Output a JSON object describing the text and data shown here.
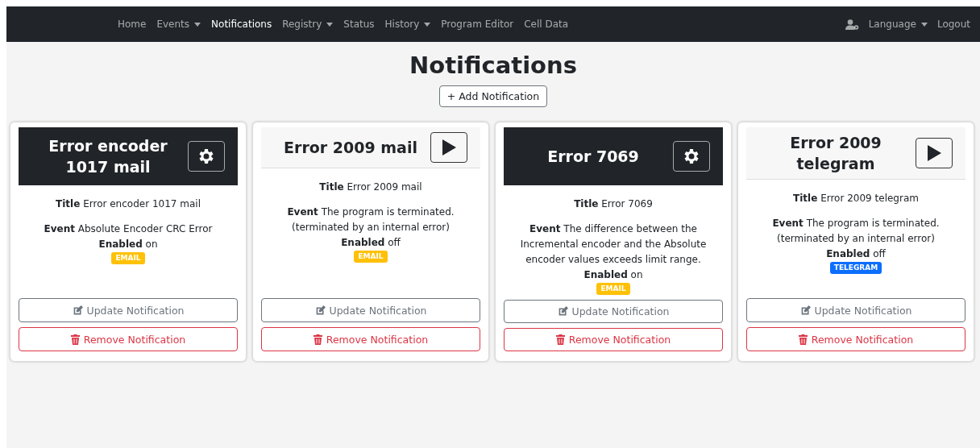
{
  "nav": {
    "items": [
      {
        "label": "Home",
        "selected": false,
        "dropdown": false
      },
      {
        "label": "Events",
        "selected": false,
        "dropdown": true
      },
      {
        "label": "Notifications",
        "selected": true,
        "dropdown": false
      },
      {
        "label": "Registry",
        "selected": false,
        "dropdown": true
      },
      {
        "label": "Status",
        "selected": false,
        "dropdown": false
      },
      {
        "label": "History",
        "selected": false,
        "dropdown": true
      },
      {
        "label": "Program Editor",
        "selected": false,
        "dropdown": false
      },
      {
        "label": "Cell Data",
        "selected": false,
        "dropdown": false
      }
    ],
    "right": [
      {
        "label": "Language",
        "dropdown": true
      },
      {
        "label": "Logout",
        "dropdown": false
      }
    ]
  },
  "page_title": "Notifications",
  "add_button": "+ Add Notification",
  "cards": [
    {
      "name": "Error encoder 1017 mail",
      "enabled": true,
      "title_label": "Title",
      "title": "Error encoder 1017 mail",
      "event_label": "Event",
      "event": "Absolute Encoder CRC Error",
      "enabled_label": "Enabled",
      "enabled_text": "on",
      "channel": {
        "label": "EMAIL",
        "kind": "email"
      },
      "update": "Update Notification",
      "remove": "Remove Notification"
    },
    {
      "name": "Error 2009 mail",
      "enabled": false,
      "title_label": "Title",
      "title": "Error 2009 mail",
      "event_label": "Event",
      "event": "The program is terminated. (terminated by an internal error)",
      "enabled_label": "Enabled",
      "enabled_text": "off",
      "channel": {
        "label": "EMAIL",
        "kind": "email"
      },
      "update": "Update Notification",
      "remove": "Remove Notification"
    },
    {
      "name": "Error 7069",
      "enabled": true,
      "title_label": "Title",
      "title": "Error 7069",
      "event_label": "Event",
      "event": "The difference between the Incremental encoder and the Absolute encoder values exceeds limit range.",
      "enabled_label": "Enabled",
      "enabled_text": "on",
      "channel": {
        "label": "EMAIL",
        "kind": "email"
      },
      "update": "Update Notification",
      "remove": "Remove Notification"
    },
    {
      "name": "Error 2009 telegram",
      "enabled": false,
      "title_label": "Title",
      "title": "Error 2009 telegram",
      "event_label": "Event",
      "event": "The program is terminated. (terminated by an internal error)",
      "enabled_label": "Enabled",
      "enabled_text": "off",
      "channel": {
        "label": "TELEGRAM",
        "kind": "telegram"
      },
      "update": "Update Notification",
      "remove": "Remove Notification"
    }
  ]
}
